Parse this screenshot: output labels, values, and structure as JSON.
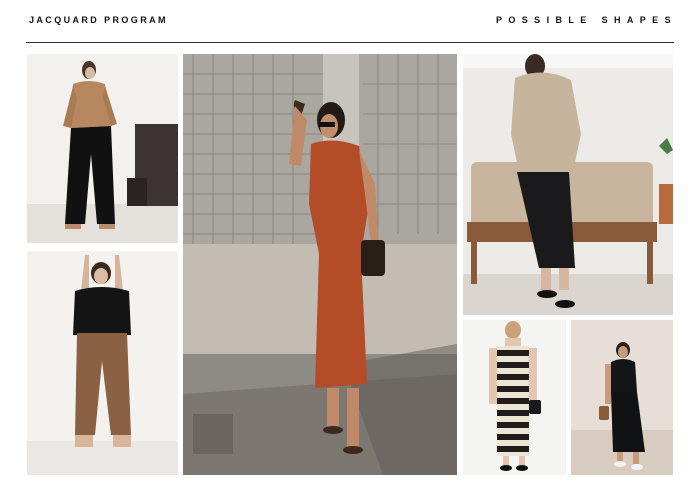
{
  "header": {
    "left_title": "JACQUARD PROGRAM",
    "right_title": "POSSIBLE SHAPES"
  },
  "photos": [
    {
      "id": "photo-camel-sweater-black-trousers",
      "icon": "photo-icon"
    },
    {
      "id": "photo-black-top-brown-trousers",
      "icon": "photo-icon"
    },
    {
      "id": "photo-rust-tshirt-dress",
      "icon": "photo-icon"
    },
    {
      "id": "photo-beige-sweater-black-skirt",
      "icon": "photo-icon"
    },
    {
      "id": "photo-striped-knit-dress",
      "icon": "photo-icon"
    },
    {
      "id": "photo-black-tshirt-black-skirt",
      "icon": "photo-icon"
    }
  ]
}
